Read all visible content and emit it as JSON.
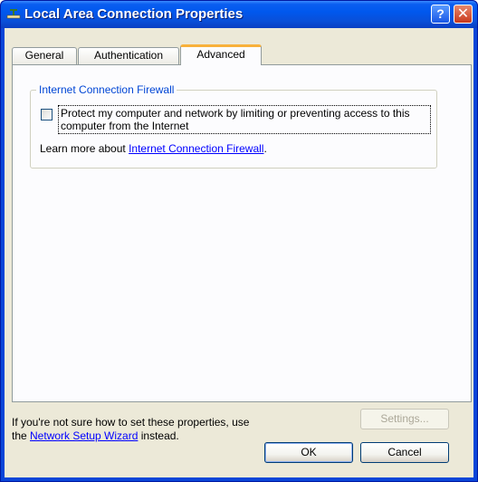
{
  "window": {
    "title": "Local Area Connection Properties",
    "help_glyph": "?",
    "close_glyph": "✕"
  },
  "tabs": [
    {
      "label": "General"
    },
    {
      "label": "Authentication"
    },
    {
      "label": "Advanced"
    }
  ],
  "firewall": {
    "group_title": "Internet Connection Firewall",
    "checkbox_label": "Protect my computer and network by limiting or preventing access to this computer from the Internet",
    "checked": false,
    "learn_prefix": "Learn more about ",
    "learn_link": "Internet Connection Firewall",
    "learn_suffix": "."
  },
  "footer": {
    "hint_line1": "If you're not sure how to set these properties, use",
    "hint_the": "the ",
    "hint_link": "Network Setup Wizard",
    "hint_suffix": " instead.",
    "settings_label": "Settings...",
    "ok_label": "OK",
    "cancel_label": "Cancel"
  },
  "colors": {
    "title_bar": "#0058ee",
    "dialog_bg": "#ece9d8",
    "group_title": "#0046d5",
    "active_tab_highlight": "#f8b13b",
    "link": "#0000ff"
  }
}
